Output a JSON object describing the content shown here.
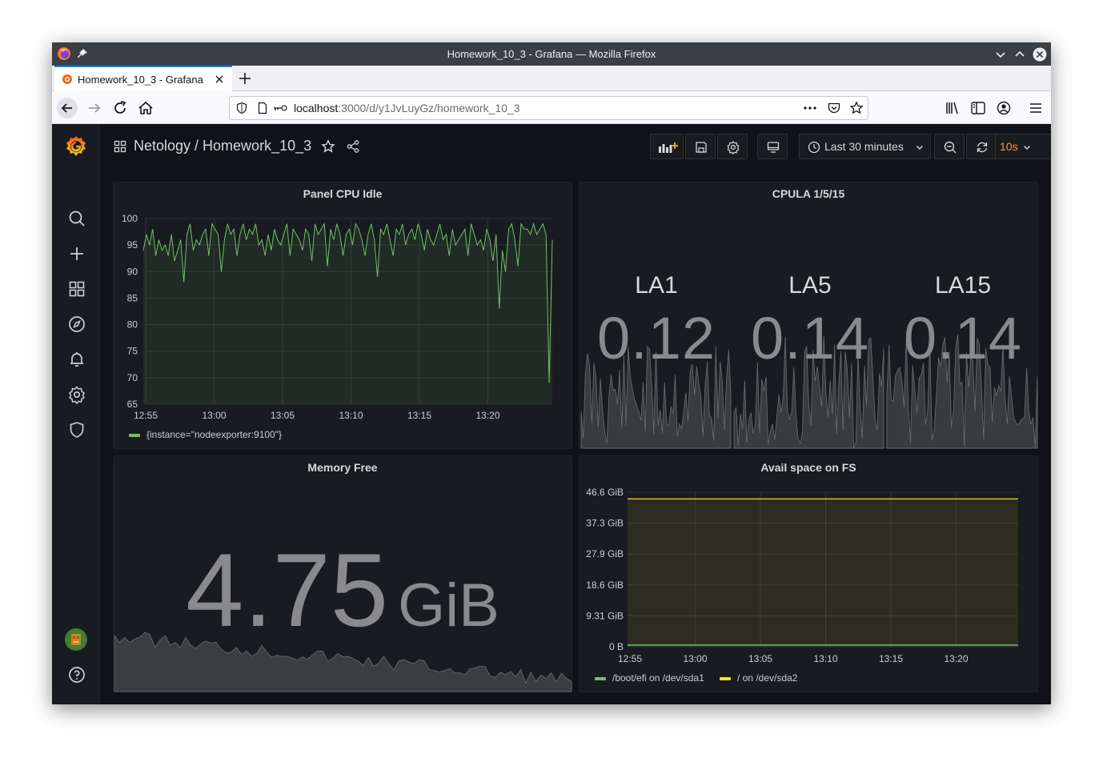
{
  "browser": {
    "window_title": "Homework_10_3 - Grafana — Mozilla Firefox",
    "tab_title": "Homework_10_3 - Grafana",
    "url_host": "localhost",
    "url_path": ":3000/d/y1JvLuyGz/homework_10_3"
  },
  "grafana": {
    "breadcrumb": "Netology / Homework_10_3",
    "time_range": "Last 30 minutes",
    "refresh_interval": "10s",
    "sidebar_icons": [
      "grafana-logo-icon",
      "search-icon",
      "plus-icon",
      "dashboards-icon",
      "explore-icon",
      "alerting-icon",
      "configuration-icon",
      "shield-icon",
      "avatar",
      "help-icon"
    ],
    "accent_color": "#ff9830",
    "series_green": "#73bf69",
    "series_yellow": "#fade2a"
  },
  "panels": {
    "cpu": {
      "title": "Panel CPU Idle",
      "legend": "{instance=\"nodeexporter:9100\"}"
    },
    "cpula": {
      "title": "CPULA 1/5/15",
      "stats": [
        {
          "name": "LA1",
          "value": "0.12"
        },
        {
          "name": "LA5",
          "value": "0.14"
        },
        {
          "name": "LA15",
          "value": "0.14"
        }
      ]
    },
    "mem": {
      "title": "Memory Free",
      "value": "4.75",
      "unit": "GiB"
    },
    "fs": {
      "title": "Avail space on FS",
      "legend": [
        "/boot/efi on /dev/sda1",
        "/ on /dev/sda2"
      ]
    }
  },
  "chart_data": [
    {
      "type": "line",
      "title": "Panel CPU Idle",
      "x": [
        "12:55",
        "13:00",
        "13:05",
        "13:10",
        "13:15",
        "13:20"
      ],
      "ylim": [
        65,
        100
      ],
      "yticks": [
        100,
        95,
        90,
        85,
        80,
        75,
        70,
        65
      ],
      "series": [
        {
          "name": "{instance=\"nodeexporter:9100\"}",
          "color": "#73bf69",
          "values": [
            94,
            97,
            95,
            98,
            93,
            96,
            94,
            95,
            93,
            97,
            92,
            94,
            96,
            88,
            97,
            99,
            94,
            96,
            95,
            97,
            98,
            93,
            99,
            98,
            97,
            90,
            96,
            99,
            97,
            98,
            93,
            97,
            99,
            96,
            98,
            97,
            99,
            95,
            96,
            93,
            97,
            94,
            98,
            96,
            95,
            97,
            99,
            93,
            98,
            97,
            96,
            94,
            98,
            97,
            92,
            99,
            97,
            98,
            99,
            91,
            98,
            96,
            99,
            97,
            93,
            97,
            98,
            95,
            99,
            98,
            96,
            93,
            97,
            99,
            96,
            89,
            98,
            97,
            99,
            96,
            93,
            98,
            97,
            99,
            95,
            97,
            98,
            96,
            99,
            97,
            94,
            98,
            96,
            95,
            97,
            99,
            96,
            97,
            93,
            98,
            95,
            96,
            97,
            98,
            93,
            99,
            97,
            95,
            96,
            94,
            98,
            96,
            92,
            97,
            83,
            94,
            90,
            98,
            99,
            96,
            91,
            99,
            98,
            98,
            97,
            99,
            97,
            98,
            99,
            97,
            69,
            96
          ]
        }
      ]
    },
    {
      "type": "line",
      "title": "Avail space on FS",
      "x": [
        "12:55",
        "13:00",
        "13:05",
        "13:10",
        "13:15",
        "13:20"
      ],
      "yticks": [
        "46.6 GiB",
        "37.3 GiB",
        "27.9 GiB",
        "18.6 GiB",
        "9.31 GiB",
        "0 B"
      ],
      "ylim_gib": [
        0,
        46.6
      ],
      "series": [
        {
          "name": "/boot/efi on /dev/sda1",
          "color": "#73bf69",
          "value_gib": 0.5
        },
        {
          "name": "/ on /dev/sda2",
          "color": "#fade2a",
          "value_gib": 44.6
        }
      ]
    }
  ]
}
